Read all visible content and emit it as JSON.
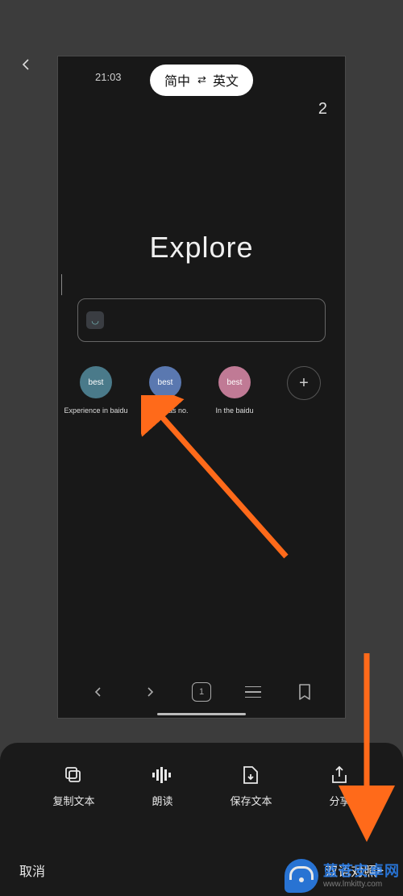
{
  "status": {
    "time": "21:03"
  },
  "translate": {
    "from": "简中",
    "to": "英文"
  },
  "count": "2",
  "title": "Explore",
  "tiles": [
    {
      "badge": "best",
      "label": "Experience in baidu"
    },
    {
      "badge": "best",
      "label": "There was no."
    },
    {
      "badge": "best",
      "label": "In the baidu"
    }
  ],
  "bottomNav": {
    "tabCount": "1"
  },
  "panel": {
    "copy": "复制文本",
    "read": "朗读",
    "save": "保存文本",
    "share": "分享",
    "cancel": "取消",
    "bilingual": "双语对照"
  },
  "watermark": {
    "brand": "蓝苍安卓网",
    "url": "www.lmkitty.com"
  }
}
